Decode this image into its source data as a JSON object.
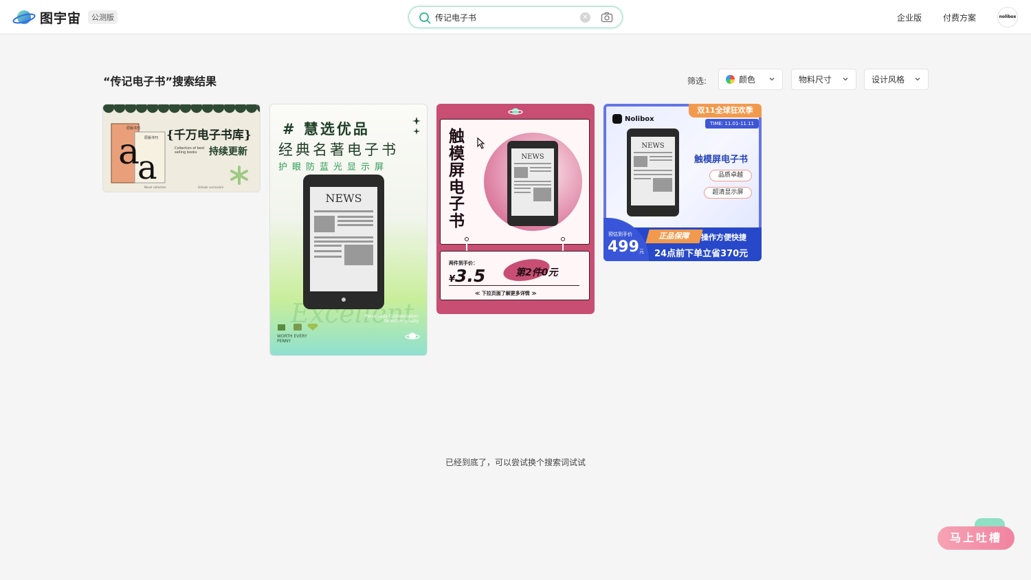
{
  "header": {
    "logo_text": "图宇宙",
    "beta_label": "公测版",
    "search": {
      "value": "传记电子书",
      "placeholder": ""
    },
    "nav": [
      "企业版",
      "付费方案"
    ],
    "avatar_text": "nolibox"
  },
  "main": {
    "title": "“传记电子书”搜索结果",
    "filter_label": "筛选:",
    "filters": [
      "颜色",
      "物料尺寸",
      "设计风格"
    ],
    "end_text": "已经到底了，可以尝试换个搜索词试试"
  },
  "cards": {
    "c1": {
      "title1": "{千万电子书库}",
      "title2": "持续更新",
      "small": "Collection of best selling books",
      "foot_left": "Novel collection",
      "foot_right": "Schook curriculum",
      "book_label": "原版书刊"
    },
    "c2": {
      "h1": "# 慧选优品",
      "h2": "经典名著电子书",
      "h3": "护眼防蓝光显示屏",
      "screen": "NEWS",
      "excellent": "Excellent",
      "pers": "Personality Customization Selection quality",
      "worth": "WORTH EVERY PENNY"
    },
    "c3": {
      "vertical": "触模屏电子书",
      "screen": "NEWS",
      "price_label": "两件到手价：",
      "yen": "¥",
      "price": "3.5",
      "second": "第2件0元",
      "more": "≪ 下拉页面了解更多详情 ≫"
    },
    "c4": {
      "brand": "Nolibox",
      "promo": "双11全球狂欢季",
      "time": "TIME: 11.01-11.11",
      "screen": "NEWS",
      "product": "触模屏电子书",
      "pill1": "品质卓越",
      "pill2": "超清显示屏",
      "est": "预估到手价",
      "price": "499",
      "yuan": "元",
      "badge": "正品保障",
      "op": "操作方便快捷",
      "save": "24点前下单立省370元"
    }
  },
  "feedback": {
    "label": "马上吐槽"
  },
  "colors": {
    "accent": "#2fb38a",
    "card3_bg": "#c84e73",
    "card4_blue": "#2748c8",
    "orange": "#f19a4d"
  }
}
